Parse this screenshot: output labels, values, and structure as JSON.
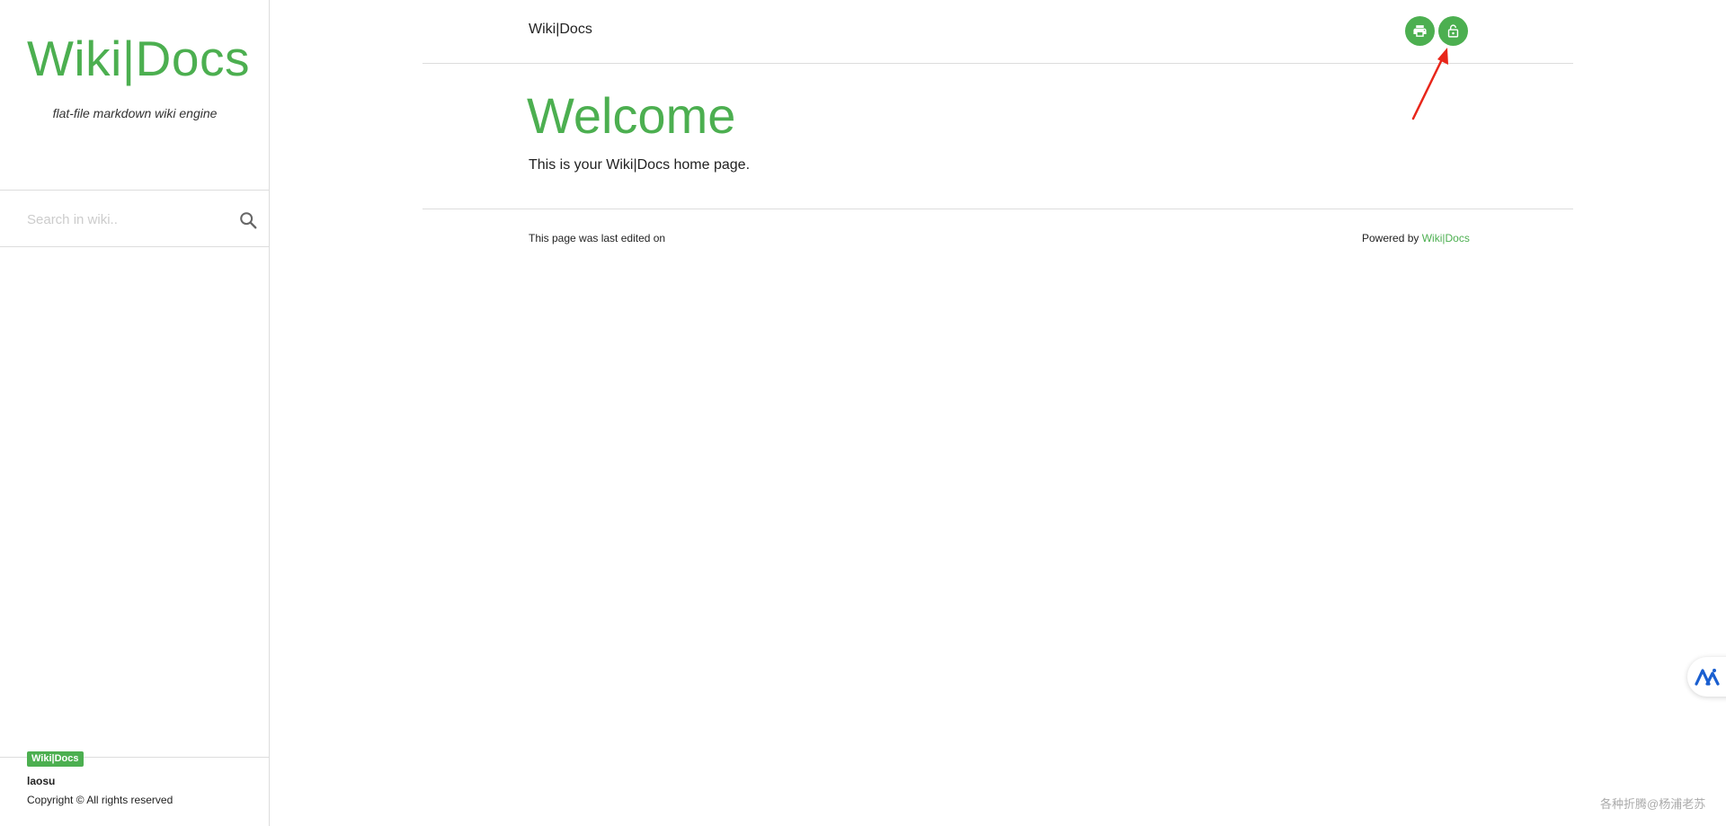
{
  "sidebar": {
    "brand_title": "Wiki|Docs",
    "brand_subtitle": "flat-file markdown wiki engine",
    "search": {
      "placeholder": "Search in wiki.."
    },
    "footer": {
      "badge": "Wiki|Docs",
      "user": "laosu",
      "copyright": "Copyright © All rights reserved"
    }
  },
  "header": {
    "title": "Wiki|Docs",
    "buttons": [
      {
        "icon": "print-icon"
      },
      {
        "icon": "lock-open-icon"
      }
    ]
  },
  "content": {
    "title": "Welcome",
    "text": "This is your Wiki|Docs home page."
  },
  "footer": {
    "last_edited": "This page was last edited on",
    "powered_prefix": "Powered by ",
    "powered_link": "Wiki|Docs"
  },
  "watermark": "各种折腾@杨浦老苏",
  "colors": {
    "accent": "#4caf50",
    "annotation": "#e8261a",
    "float_icon": "#1a5fd0"
  }
}
